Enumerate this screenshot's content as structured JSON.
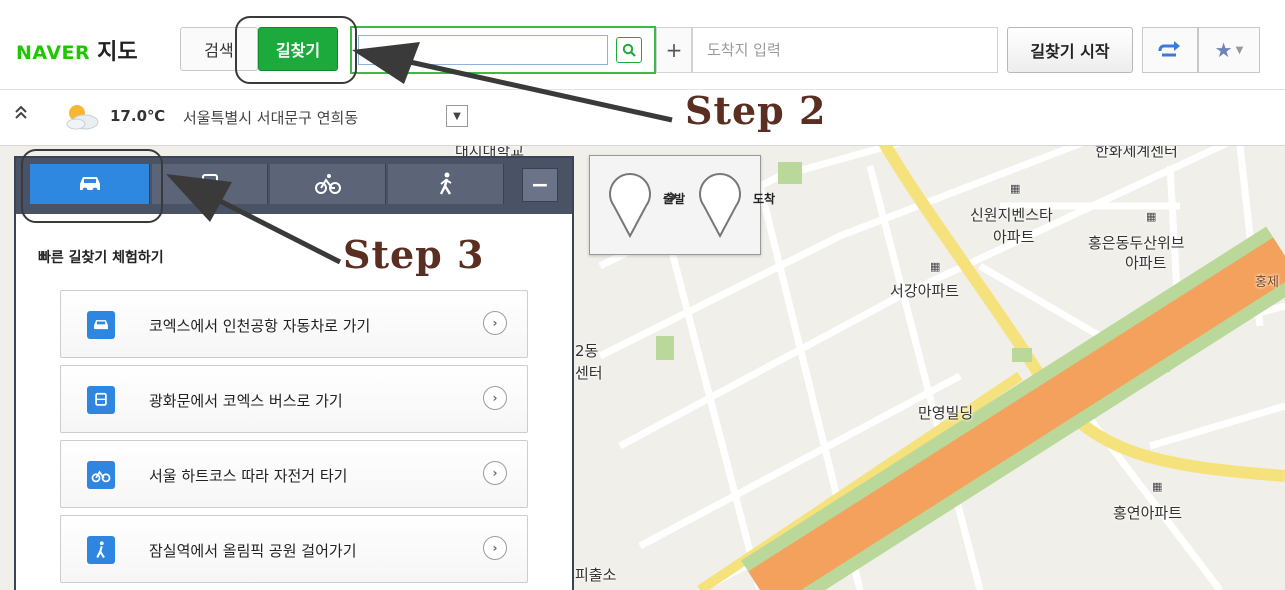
{
  "header": {
    "brand": "NAVER",
    "service": "지도",
    "tabs": [
      {
        "label": "검색"
      },
      {
        "label": "길찾기"
      }
    ],
    "start_input": {
      "value": "",
      "placeholder": ""
    },
    "dest_input": {
      "value": "",
      "placeholder": "도착지 입력"
    },
    "route_start_label": "길찾기 시작",
    "add_waypoint": "+",
    "swap_icon": "swap-arrow-icon",
    "fav_icon": "star-icon"
  },
  "weather": {
    "temperature": "17.0℃",
    "location": "서울특별시 서대문구 연희동",
    "icon": "partly-sunny-icon"
  },
  "panel": {
    "modes": [
      {
        "name": "car",
        "icon": "car-icon"
      },
      {
        "name": "bus",
        "icon": "bus-icon"
      },
      {
        "name": "bike",
        "icon": "bicycle-icon"
      },
      {
        "name": "walk",
        "icon": "walking-person-icon"
      }
    ],
    "minimize_label": "−",
    "quick_title": "빠른 길찾기 체험하기",
    "quick_items": [
      {
        "label": "코엑스에서 인천공항 자동차로 가기",
        "icon": "car-icon"
      },
      {
        "label": "광화문에서 코엑스 버스로 가기",
        "icon": "bus-icon"
      },
      {
        "label": "서울 하트코스 따라 자전거 타기",
        "icon": "bicycle-icon"
      },
      {
        "label": "잠실역에서 올림픽 공원 걸어가기",
        "icon": "walking-person-icon"
      }
    ]
  },
  "markers": {
    "start": "출발",
    "end": "도착"
  },
  "map_labels": {
    "apt1_line1": "신원지벤스타",
    "apt1_line2": "아파트",
    "apt2_line1": "홍은동두산위브",
    "apt2_line2": "아파트",
    "apt3": "서강아파트",
    "bldg1": "만영빌딩",
    "apt4": "홍연아파트",
    "partial_top_left": "대지대학교",
    "partial_top_right": "한화세계센터",
    "partial_dong": "2동",
    "partial_center": "센터",
    "partial_police": "피출소",
    "partial_road": "홍제"
  },
  "annotations": {
    "step2": "Step 2",
    "step3": "Step 3",
    "color": "#5a2e20"
  },
  "colors": {
    "naver_green": "#1ec800",
    "route_tab_green": "#1daa3c",
    "mode_active_blue": "#2f88e0",
    "panel_dark": "#4a5266",
    "expressway_orange": "#f3a15c"
  }
}
